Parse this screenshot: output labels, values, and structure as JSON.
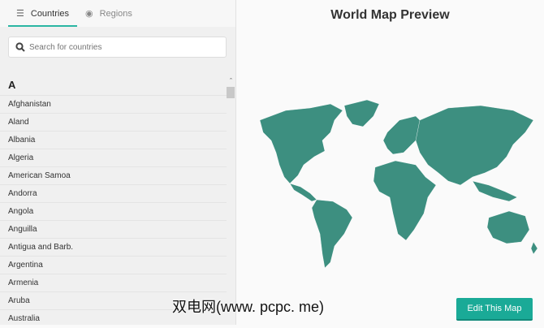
{
  "tabs": [
    {
      "label": "Countries",
      "icon": "list-icon"
    },
    {
      "label": "Regions",
      "icon": "map-pin-icon"
    }
  ],
  "search": {
    "placeholder": "Search for countries"
  },
  "letter": "A",
  "countries": [
    "Afghanistan",
    "Aland",
    "Albania",
    "Algeria",
    "American Samoa",
    "Andorra",
    "Angola",
    "Anguilla",
    "Antigua and Barb.",
    "Argentina",
    "Armenia",
    "Aruba",
    "Australia"
  ],
  "preview": {
    "title": "World Map Preview",
    "map_color": "#3d8f80"
  },
  "button": {
    "label": "Edit This Map"
  },
  "watermark": "双电网(www. pcpc. me)"
}
